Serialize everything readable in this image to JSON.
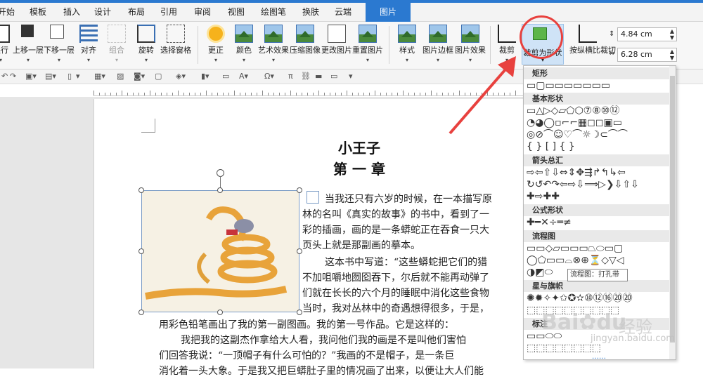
{
  "tabs": [
    "开始",
    "模板",
    "插入",
    "设计",
    "布局",
    "引用",
    "审阅",
    "视图",
    "绘图笔",
    "换肤",
    "云端",
    "图片"
  ],
  "ribbon": {
    "arrange": [
      "换行",
      "上移一层",
      "下移一层",
      "对齐",
      "组合",
      "旋转",
      "选择窗格"
    ],
    "adjust": [
      "更正",
      "颜色",
      "艺术效果",
      "压缩图像",
      "更改图片",
      "重置图片"
    ],
    "style": [
      "样式",
      "图片边框",
      "图片效果"
    ],
    "crop": "裁剪",
    "crop_shape": "裁剪为形状",
    "crop_ratio": "按纵横比裁切",
    "height": "4.84 cm",
    "width": "6.28 cm"
  },
  "doc": {
    "title": "小王子",
    "chapter": "第 一 章",
    "lines": [
      "当我还只有六岁的时候，在一本描写原",
      "林的名叫《真实的故事》的书中，看到了一",
      "彩的插画，画的是一条蟒蛇正在吞食一只大",
      "页头上就是那副画的摹本。",
      "这本书中写道：“这些蟒蛇把它们的猎",
      "不加咀嚼地囫囵吞下，尔后就不能再动弹了",
      "们就在长长的六个月的睡眠中消化这些食物",
      "当时，我对丛林中的奇遇想得很多，于是，",
      "用彩色铅笔画出了我的第一副图画。我的第一号作品。它是这样的：",
      "我把我的这副杰作拿给大人看，我问他们我的画是不是叫他们害怕",
      "们回答我说：“一顶帽子有什么可怕的？”我画的不是帽子，是一条巨",
      "消化着一头大象。于是我又把巨蟒肚子里的情况画了出来，以便让大人们能"
    ]
  },
  "gallery": {
    "sections": [
      "矩形",
      "基本形状",
      "箭头总汇",
      "公式形状",
      "流程图",
      "星与旗帜",
      "标注"
    ],
    "rows": [
      "▭▢▭▭▭▭▭▭▭",
      "▭△▷◇▱⬠⬡⑦⑧⑩⑫",
      "◔◕◯▫⌐⌐▦◻◻▣▭",
      "◎⊘⌒☺♡⌒☼☽⊂⌒⌒",
      "{ } [ ] { }",
      "⇨⇦⇧⇩⇔⇕✥⇶↱↰↳⇦",
      "↻↺↶↷⇦⇨⇩⟹▷❯⇩⇧⇩",
      "✚⇨✚✚",
      "✚━✕÷═≠",
      "▭▭◇▱▭▭▭⏢⬭▭▢",
      "◯⬠▭▭⌓⊗⊕⏳◇▽◁",
      "◑◩⬭",
      "✺✹✧✦✩✪✫⑩⑫⑯⑳⑳",
      "⬚⬚⬚⬚⬚⬚⬚⬚⬚⬚",
      "▭▭⬭⬭",
      "⬚⬚⬚⬚⬚⬚⬚⬚",
      "⬚⬚⬚⬚⬚⬚"
    ],
    "tooltip": "流程图：打孔带",
    "more": "……"
  },
  "watermark": {
    "brand": "Bai",
    "paw": "du",
    "suffix": "经验",
    "url": "jingyan.baidu.com"
  },
  "colors": {
    "accent": "#2b79d0",
    "highlight": "#e8413e"
  }
}
